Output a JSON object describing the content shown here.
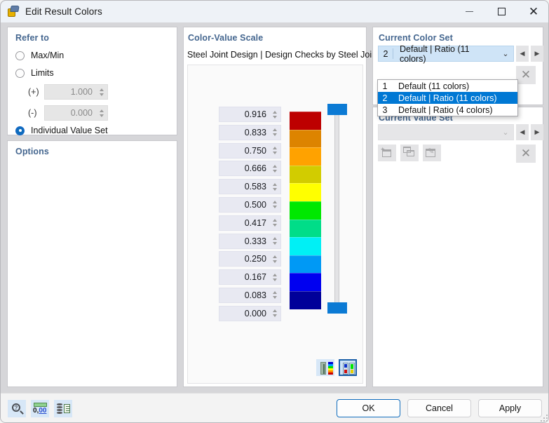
{
  "window": {
    "title": "Edit Result Colors",
    "icon": "result-colors-icon",
    "minimize": "–",
    "maximize": "□",
    "close": "✕"
  },
  "refer_to": {
    "title": "Refer to",
    "options": [
      {
        "label": "Max/Min",
        "selected": false
      },
      {
        "label": "Limits",
        "selected": false
      },
      {
        "label": "Individual Value Set",
        "selected": true
      }
    ],
    "limits": [
      {
        "label": "(+)",
        "value": "1.000",
        "enabled": false
      },
      {
        "label": "(-)",
        "value": "0.000",
        "enabled": false
      }
    ]
  },
  "options": {
    "title": "Options"
  },
  "color_value_scale": {
    "title": "Color-Value Scale",
    "subtitle": "Steel Joint Design | Design Checks by Steel Joints",
    "values": [
      "0.916",
      "0.833",
      "0.750",
      "0.666",
      "0.583",
      "0.500",
      "0.417",
      "0.333",
      "0.250",
      "0.167",
      "0.083",
      "0.000"
    ],
    "swatches": [
      "#bd0000",
      "#dd8400",
      "#ffa200",
      "#d2cc00",
      "#ffff00",
      "#00e800",
      "#00dd88",
      "#00f0f5",
      "#0099f5",
      "#0000f0",
      "#000099"
    ],
    "slider": {
      "top_handle": "slider-handle-top",
      "bottom_handle": "slider-handle-bottom"
    },
    "legend_buttons": [
      {
        "name": "smooth-color-scale-button",
        "selected": false
      },
      {
        "name": "stepped-color-scale-button",
        "selected": true
      }
    ]
  },
  "current_color_set": {
    "title": "Current Color Set",
    "selected": {
      "number": "2",
      "label": "Default | Ratio (11 colors)"
    },
    "caret": "⌄",
    "prev": "◀",
    "next": "▶",
    "delete": "✕",
    "dropdown_open": true,
    "dropdown_items": [
      {
        "number": "1",
        "label": "Default (11 colors)",
        "highlighted": false
      },
      {
        "number": "2",
        "label": "Default | Ratio (11 colors)",
        "highlighted": true
      },
      {
        "number": "3",
        "label": "Default | Ratio (4 colors)",
        "highlighted": false
      }
    ]
  },
  "current_value_set": {
    "title": "Current Value Set",
    "selected_label": "",
    "caret": "⌄",
    "prev": "◀",
    "next": "▶",
    "delete": "✕",
    "tool_buttons": [
      {
        "name": "new-value-set-button"
      },
      {
        "name": "duplicate-value-set-button"
      },
      {
        "name": "edit-value-set-button"
      }
    ]
  },
  "footer": {
    "tools": [
      {
        "name": "help-button",
        "icon": "question-magnifier-icon"
      },
      {
        "name": "decimal-places-button",
        "icon": "number-format-icon",
        "text_main": "0,",
        "text_underlined": "00"
      },
      {
        "name": "copy-to-clipboard-button",
        "icon": "stack-to-document-icon"
      }
    ],
    "buttons": [
      {
        "label": "OK",
        "primary": true
      },
      {
        "label": "Cancel",
        "primary": false
      },
      {
        "label": "Apply",
        "primary": false
      }
    ]
  }
}
